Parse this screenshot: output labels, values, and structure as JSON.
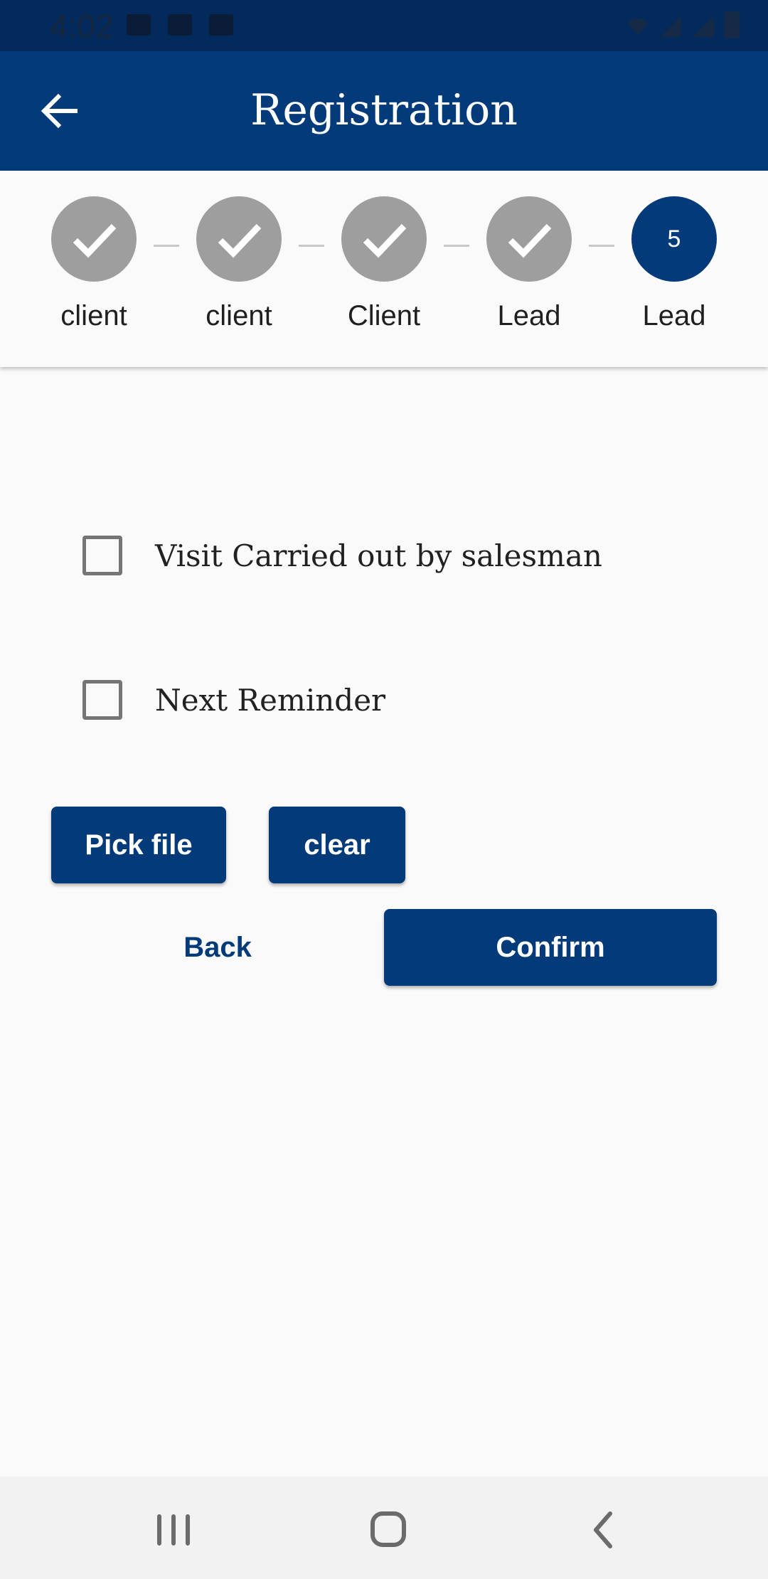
{
  "status_bar": {
    "time": "4:02",
    "icons": [
      "image-icon",
      "cast-icon",
      "checkbox-icon",
      "wifi-icon",
      "signal-icon",
      "signal-icon",
      "battery-icon"
    ]
  },
  "app_bar": {
    "title": "Registration",
    "back_icon": "arrow-left-icon"
  },
  "stepper": {
    "steps": [
      {
        "label": "client",
        "state": "completed"
      },
      {
        "label": "client",
        "state": "completed"
      },
      {
        "label": "Client",
        "state": "completed"
      },
      {
        "label": "Lead",
        "state": "completed"
      },
      {
        "label": "Lead",
        "state": "active",
        "number": "5"
      }
    ]
  },
  "form": {
    "visit_checkbox": {
      "label": "Visit Carried out by salesman",
      "checked": false
    },
    "reminder_checkbox": {
      "label": "Next Reminder",
      "checked": false
    },
    "pick_file_label": "Pick file",
    "clear_label": "clear",
    "back_label": "Back",
    "confirm_label": "Confirm"
  },
  "nav_bar": {
    "recents_icon": "recents-icon",
    "home_icon": "home-icon",
    "back_icon": "back-chevron-icon"
  },
  "colors": {
    "primary": "#023a7a",
    "status_bar": "#022a5c",
    "step_done": "#9e9e9e",
    "background": "#fafafa"
  }
}
